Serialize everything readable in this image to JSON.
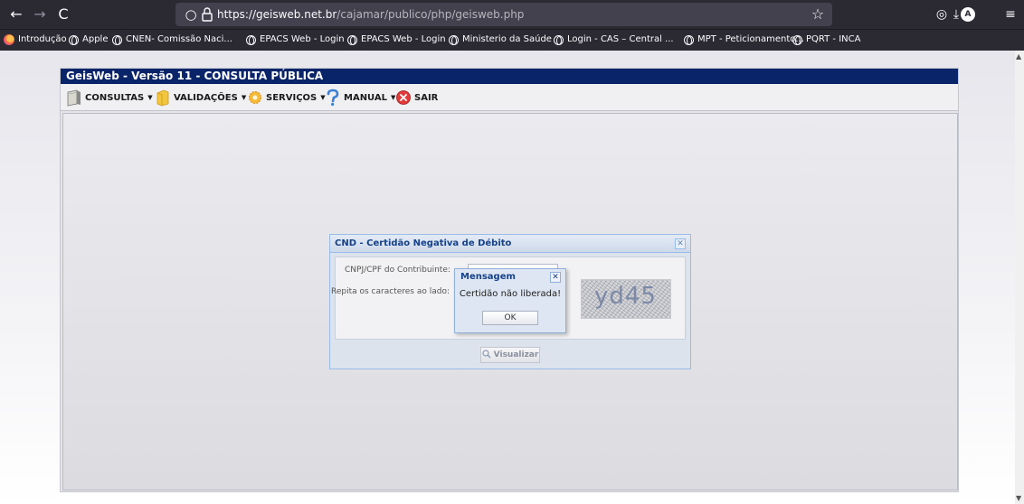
{
  "browser": {
    "url_host": "https://geisweb.net.br",
    "url_path": "/cajamar/publico/php/geisweb.php",
    "bookmarks": [
      "Introdução",
      "Apple",
      "CNEN- Comissão Naci...",
      "EPACS Web - Login",
      "EPACS Web - Login",
      "Ministerio da Saúde",
      "Login - CAS – Central ...",
      "MPT - Peticionamento...",
      "PQRT - INCA"
    ]
  },
  "app": {
    "title": "GeisWeb - Versão 11 - CONSULTA PÚBLICA",
    "menu": {
      "consultas": "CONSULTAS",
      "validacoes": "VALIDAÇÕES",
      "servicos": "SERVIÇOS",
      "manual": "MANUAL",
      "sair": "SAIR"
    }
  },
  "cnd": {
    "title": "CND - Certidão Negativa de Débito",
    "cnpj_label": "CNPJ/CPF do Contribuinte:",
    "captcha_label": "Repita os caracteres ao lado:",
    "captcha_text": "yd45",
    "visualizar": "Visualizar"
  },
  "message": {
    "title": "Mensagem",
    "text": "Certidão não liberada!",
    "ok": "OK"
  }
}
